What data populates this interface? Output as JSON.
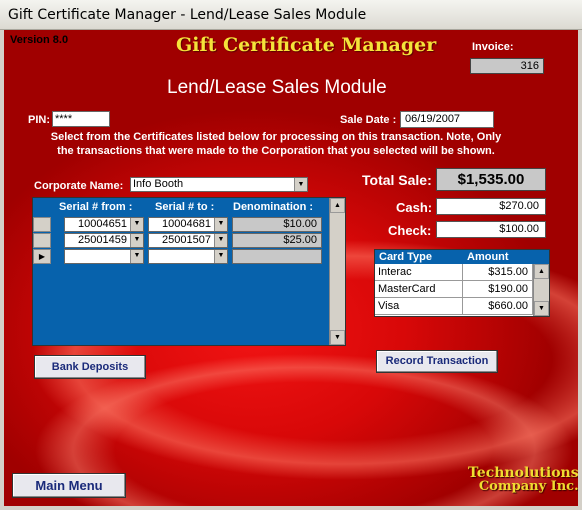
{
  "window": {
    "title": "Gift Certificate Manager - Lend/Lease Sales Module"
  },
  "header": {
    "version": "Version 8.0",
    "app_title": "Gift Certificate Manager",
    "module_title": "Lend/Lease Sales Module"
  },
  "invoice": {
    "label": "Invoice:",
    "value": "316"
  },
  "pin": {
    "label": "PIN:",
    "value": "****"
  },
  "sale_date": {
    "label": "Sale Date :",
    "value": "06/19/2007"
  },
  "instructions": {
    "line1": "Select from the Certificates listed below for processing on this transaction.  Note, Only",
    "line2": "the transactions that were made to the Corporation that you selected will be shown."
  },
  "corporate": {
    "label": "Corporate Name:",
    "value": "Info Booth"
  },
  "grid": {
    "headers": {
      "from": "Serial # from :",
      "to": "Serial # to :",
      "denom": "Denomination :"
    },
    "rows": [
      {
        "from": "10004651",
        "to": "10004681",
        "denom": "$10.00"
      },
      {
        "from": "25001459",
        "to": "25001507",
        "denom": "$25.00"
      },
      {
        "from": "",
        "to": "",
        "denom": ""
      }
    ],
    "new_row_marker": "▶"
  },
  "totals": {
    "total_label": "Total Sale:",
    "total_value": "$1,535.00",
    "cash_label": "Cash:",
    "cash_value": "$270.00",
    "check_label": "Check:",
    "check_value": "$100.00"
  },
  "cards": {
    "headers": {
      "type": "Card Type",
      "amount": "Amount"
    },
    "rows": [
      {
        "type": "Interac",
        "amount": "$315.00"
      },
      {
        "type": "MasterCard",
        "amount": "$190.00"
      },
      {
        "type": "Visa",
        "amount": "$660.00"
      }
    ]
  },
  "buttons": {
    "record": "Record Transaction",
    "bank": "Bank Deposits",
    "main_menu": "Main Menu"
  },
  "brand": {
    "line1": "Technolutions",
    "line2": "Company Inc."
  },
  "colors": {
    "background": "#cc0000",
    "accent_title": "#f5e33a",
    "grid_blue": "#0762ac"
  }
}
